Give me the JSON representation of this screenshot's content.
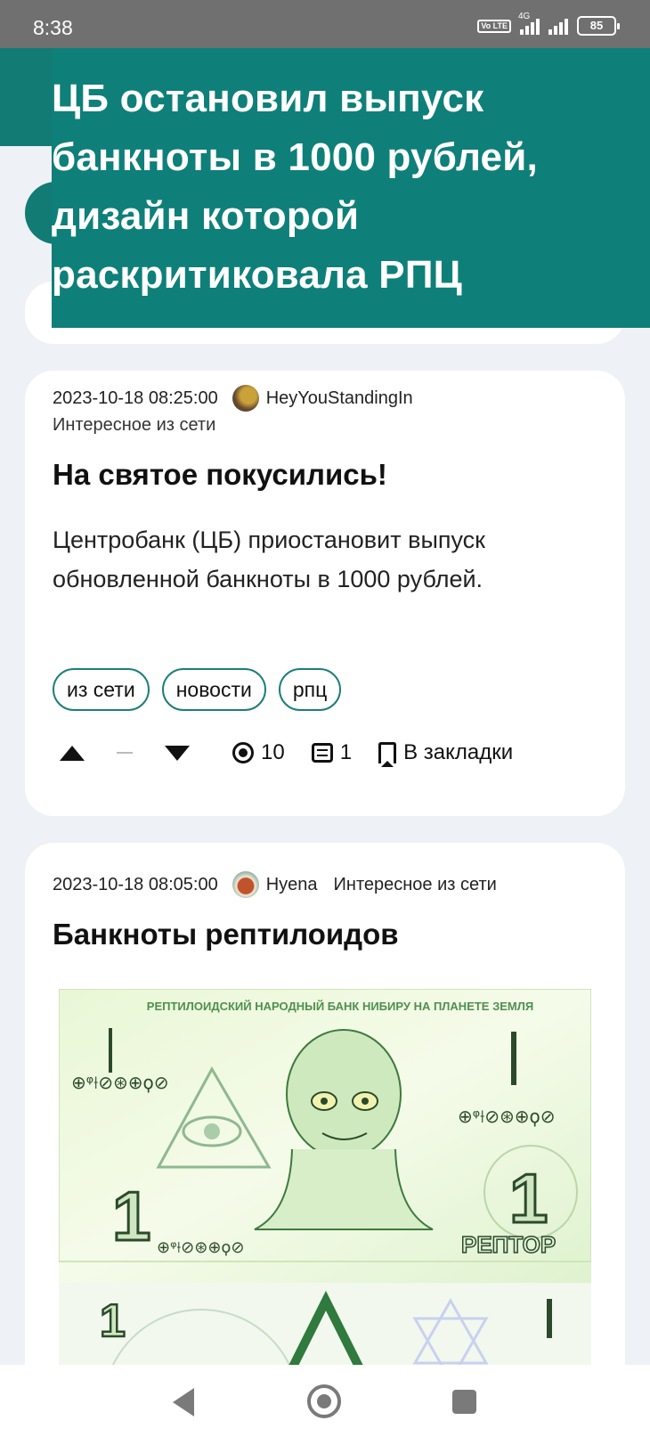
{
  "status_bar": {
    "time": "8:38",
    "volte": "Vo LTE",
    "network": "4G",
    "battery": "85"
  },
  "notification": {
    "headline": "ЦБ остановил выпуск банкноты в 1000 рублей, дизайн которой раскритиковала РПЦ"
  },
  "posts": [
    {
      "date": "2023-10-18 08:25:00",
      "author": "HeyYouStandingIn",
      "category": "Интересное из сети",
      "title": "На святое покусились!",
      "body": "Центробанк (ЦБ) приостановит выпуск обновленной банкноты в 1000 рублей.",
      "tags": [
        "из сети",
        "новости",
        "рпц"
      ],
      "rating": "—",
      "views": "10",
      "comments": "1",
      "bookmark_label": "В закладки"
    },
    {
      "date": "2023-10-18 08:05:00",
      "author": "Hyena",
      "category": "Интересное из сети",
      "title": "Банкноты рептилоидов",
      "image": {
        "top_text": "РЕПТИЛОИДСКИЙ НАРОДНЫЙ БАНК НИБИРУ НА ПЛАНЕТЕ ЗЕМЛЯ",
        "denomination": "1",
        "currency": "РЕПТОР",
        "glyphs": "⊕ᵠ⟊⊘⊛⊕ϙ⊘"
      }
    }
  ],
  "icons": {
    "upvote": "upvote-icon",
    "downvote": "downvote-icon",
    "views": "eye-icon",
    "comments": "comment-icon",
    "bookmark": "bookmark-icon"
  },
  "colors": {
    "brand": "#0f7f79",
    "status_bar": "#707070",
    "page_bg": "#eef1f5"
  }
}
